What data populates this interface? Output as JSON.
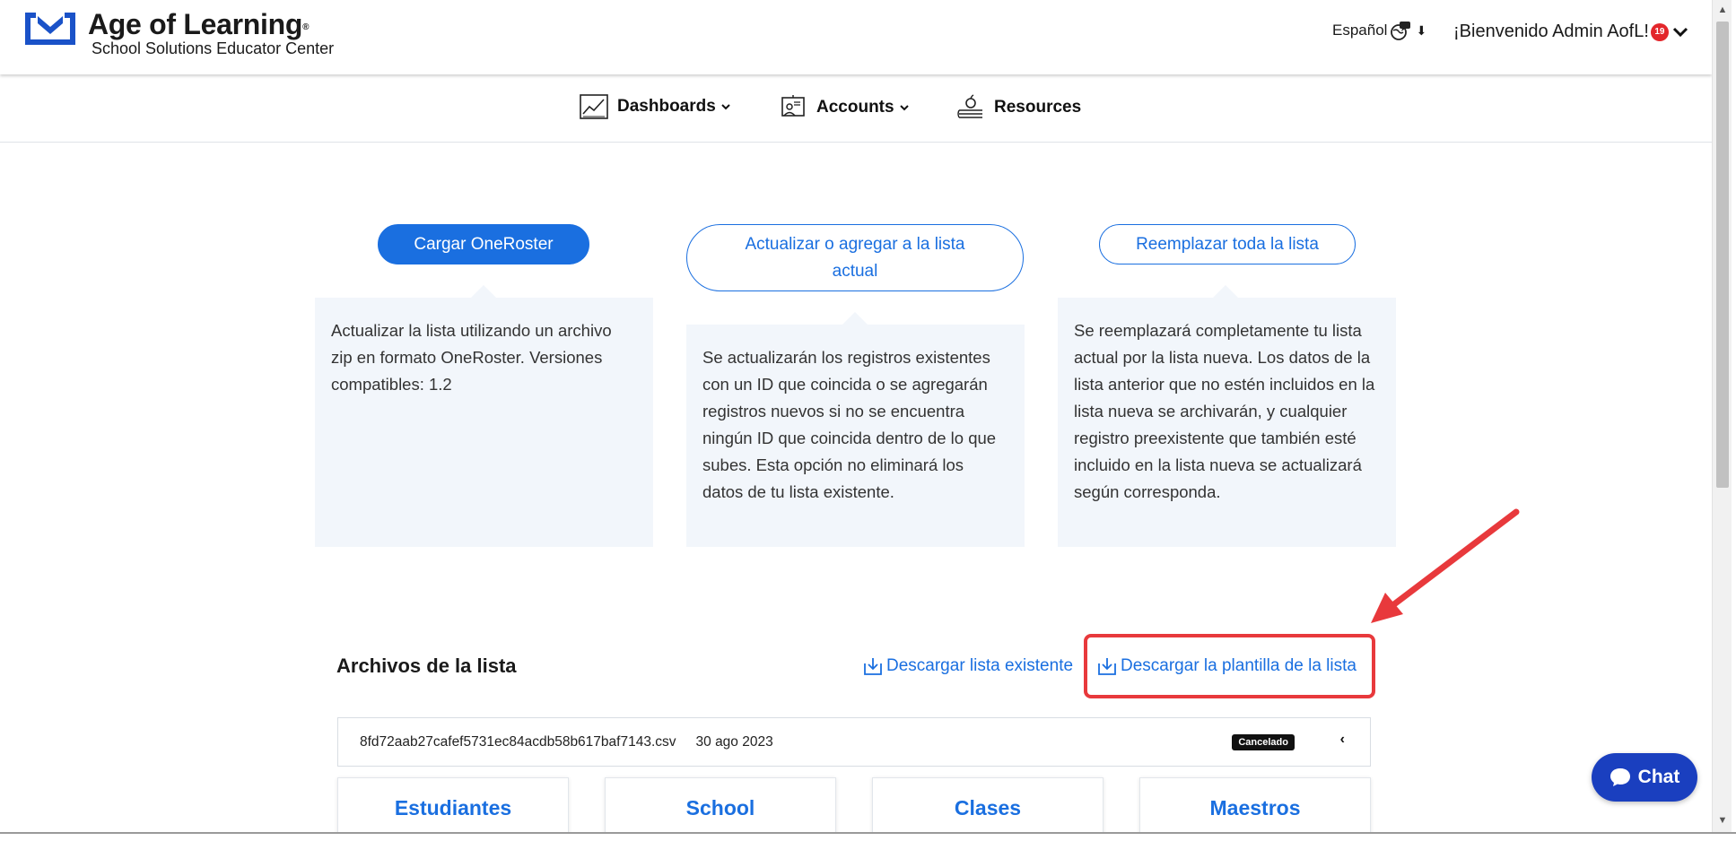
{
  "header": {
    "brand_title": "Age of Learning",
    "brand_reg": "®",
    "brand_subtitle": "School Solutions Educator Center",
    "language_label": "Español",
    "welcome_text": "¡Bienvenido Admin AofL!",
    "notification_count": "19"
  },
  "nav": {
    "items": [
      {
        "label": "Dashboards",
        "icon": "chart-line-icon",
        "has_dropdown": true
      },
      {
        "label": "Accounts",
        "icon": "teacher-board-icon",
        "has_dropdown": true
      },
      {
        "label": "Resources",
        "icon": "books-apple-icon",
        "has_dropdown": false
      }
    ]
  },
  "options": [
    {
      "button_label": "Cargar OneRoster",
      "selected": true,
      "description": "Actualizar la lista utilizando un archivo zip en formato OneRoster. Versiones compatibles: 1.2"
    },
    {
      "button_label": "Actualizar o agregar a la lista actual",
      "selected": false,
      "description": "Se actualizarán los registros existentes con un ID que coincida o se agregarán registros nuevos si no se encuentra ningún ID que coincida dentro de lo que subes. Esta opción no eliminará los datos de tu lista existente."
    },
    {
      "button_label": "Reemplazar toda la lista",
      "selected": false,
      "description": "Se reemplazará completamente tu lista actual por la lista nueva. Los datos de la lista anterior que no estén incluidos en la lista nueva se archivarán, y cualquier registro preexistente que también esté incluido en la lista nueva se actualizará según corresponda."
    }
  ],
  "files": {
    "title": "Archivos de la lista",
    "download_existing_label": "Descargar lista existente",
    "download_template_label": "Descargar la plantilla de la lista",
    "rows": [
      {
        "file_name": "8fd72aab27cafef5731ec84acdb58b617baf7143.csv",
        "date": "30 ago 2023",
        "status": "Cancelado"
      }
    ],
    "cards": [
      "Estudiantes",
      "School",
      "Clases",
      "Maestros"
    ]
  },
  "chat": {
    "label": "Chat"
  },
  "colors": {
    "accent": "#1a6fe0",
    "annotation": "#e8393c",
    "chat_bg": "#1a3fbf",
    "panel_bg": "#f2f6fb",
    "badge": "#e3262b"
  }
}
